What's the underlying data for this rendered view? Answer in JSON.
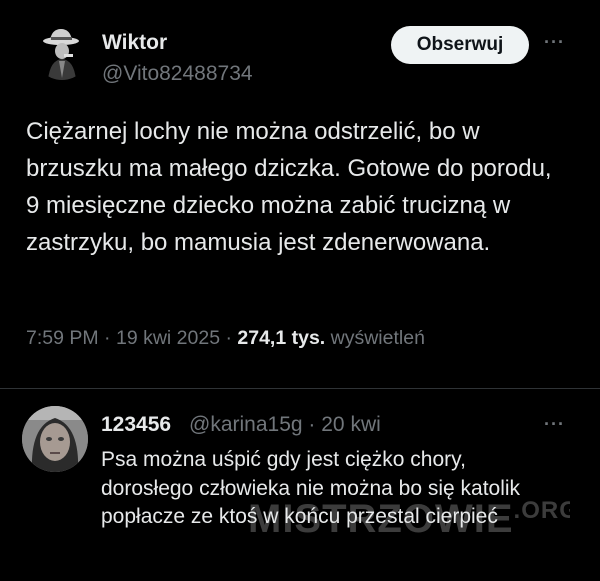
{
  "main_tweet": {
    "author_name": "Wiktor",
    "author_handle": "@Vito82488734",
    "follow_label": "Obserwuj",
    "more_label": "···",
    "text": "Ciężarnej lochy nie można odstrzelić, bo w brzuszku ma małego dziczka. Gotowe do porodu, 9 miesięczne dziecko można zabić trucizną w zastrzyku, bo mamusia jest zdenerwowana.",
    "time": "7:59 PM",
    "separator": "·",
    "date": "19 kwi 2025",
    "views_count": "274,1 tys.",
    "views_label": "wyświetleń"
  },
  "reply_tweet": {
    "author_name": "123456",
    "author_handle": "@karina15g",
    "separator": "·",
    "date": "20 kwi",
    "more_label": "···",
    "text": "Psa można uśpić gdy jest ciężko chory, dorosłego człowieka nie można bo się katolik popłacze ze ktoś w końcu przestal cierpieć"
  },
  "watermark": {
    "text": "MISTRZOWIE",
    "suffix": ".ORG"
  }
}
